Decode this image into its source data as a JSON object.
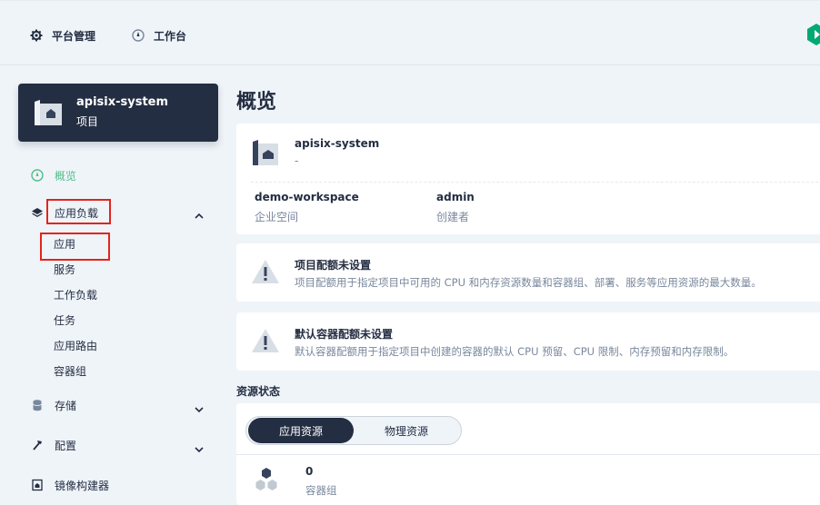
{
  "topnav": {
    "platform_label": "平台管理",
    "workbench_label": "工作台"
  },
  "project": {
    "name": "apisix-system",
    "type_label": "项目"
  },
  "sidebar": {
    "overview": "概览",
    "workloads_group": "应用负载",
    "workload_items": [
      "应用",
      "服务",
      "工作负载",
      "任务",
      "应用路由",
      "容器组"
    ],
    "storage": "存储",
    "config": "配置",
    "image_builder": "镜像构建器"
  },
  "main": {
    "title": "概览",
    "project_name": "apisix-system",
    "project_desc": "-",
    "workspace_value": "demo-workspace",
    "workspace_label": "企业空间",
    "creator_value": "admin",
    "creator_label": "创建者",
    "quota_title": "项目配额未设置",
    "quota_desc": "项目配额用于指定项目中可用的 CPU 和内存资源数量和容器组、部署、服务等应用资源的最大数量。",
    "default_quota_title": "默认容器配额未设置",
    "default_quota_desc": "默认容器配额用于指定项目中创建的容器的默认 CPU 预留、CPU 限制、内存预留和内存限制。",
    "resource_status_label": "资源状态",
    "tab_app_resources": "应用资源",
    "tab_physical_resources": "物理资源",
    "pods_count": "0",
    "pods_label": "容器组"
  },
  "colors": {
    "accent_green": "#55bc8a",
    "dark": "#242e42",
    "highlight_red": "#e3241b"
  }
}
